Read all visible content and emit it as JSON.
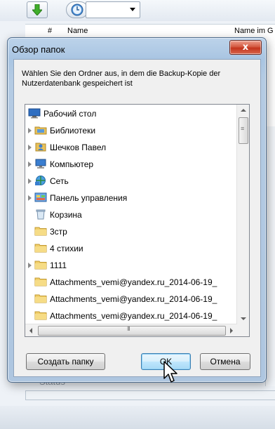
{
  "background": {
    "header": {
      "num": "#",
      "name": "Name",
      "name2": "Name im G"
    },
    "status_label": "Status"
  },
  "dialog": {
    "title": "Обзор папок",
    "close_label": "x",
    "description": "Wählen Sie den Ordner aus, in dem die Backup-Kopie der Nutzerdatenbank gespeichert ist",
    "tree": [
      {
        "label": "Рабочий стол",
        "icon": "desktop-icon",
        "expander": false,
        "indent": 0,
        "selected": true
      },
      {
        "label": "Библиотеки",
        "icon": "libraries-icon",
        "expander": true,
        "indent": 1
      },
      {
        "label": "Шечков Павел",
        "icon": "user-folder-icon",
        "expander": true,
        "indent": 1
      },
      {
        "label": "Компьютер",
        "icon": "computer-icon",
        "expander": true,
        "indent": 1
      },
      {
        "label": "Сеть",
        "icon": "network-icon",
        "expander": true,
        "indent": 1
      },
      {
        "label": "Панель управления",
        "icon": "control-panel-icon",
        "expander": true,
        "indent": 1
      },
      {
        "label": "Корзина",
        "icon": "recycle-bin-icon",
        "expander": false,
        "indent": 1
      },
      {
        "label": "3стр",
        "icon": "folder-icon",
        "expander": false,
        "indent": 1
      },
      {
        "label": "4 стихии",
        "icon": "folder-icon",
        "expander": false,
        "indent": 1
      },
      {
        "label": "1111",
        "icon": "folder-icon",
        "expander": true,
        "indent": 1
      },
      {
        "label": "Attachments_vemi@yandex.ru_2014-06-19_",
        "icon": "folder-icon",
        "expander": false,
        "indent": 1
      },
      {
        "label": "Attachments_vemi@yandex.ru_2014-06-19_",
        "icon": "folder-icon",
        "expander": false,
        "indent": 1
      },
      {
        "label": "Attachments_vemi@yandex.ru_2014-06-19_",
        "icon": "folder-icon",
        "expander": false,
        "indent": 1
      }
    ],
    "buttons": {
      "new_folder": "Создать папку",
      "ok": "OK",
      "cancel": "Отмена"
    }
  }
}
